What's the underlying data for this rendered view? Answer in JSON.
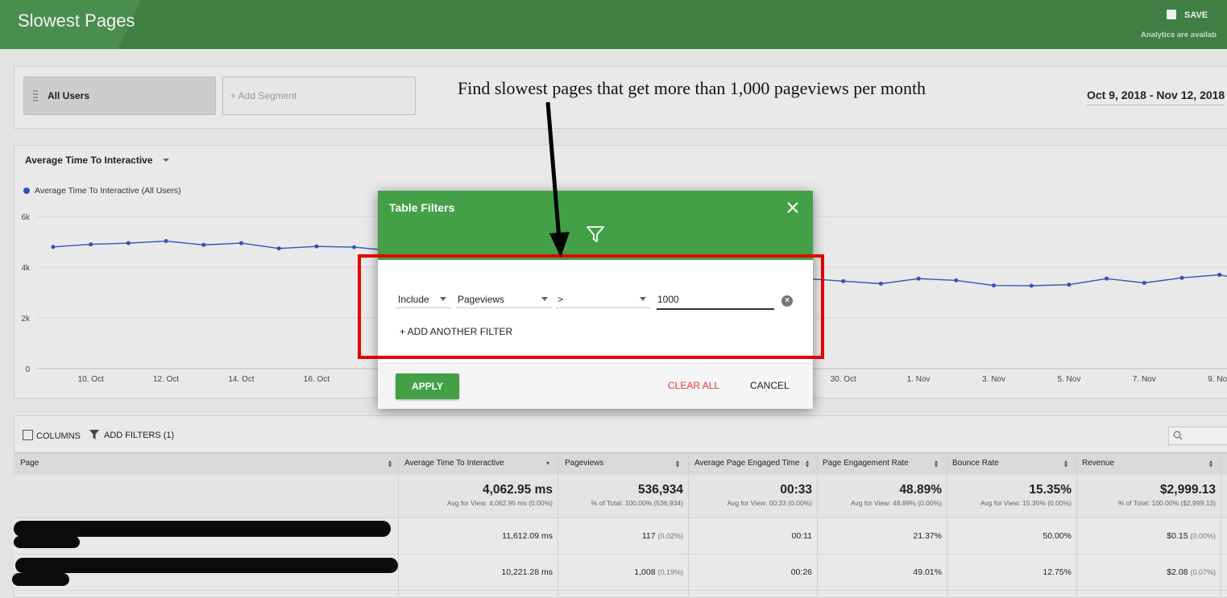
{
  "header": {
    "title": "Slowest Pages",
    "save_label": "SAVE",
    "availability_note": "Analytics are availab"
  },
  "segments": {
    "active": "All Users",
    "add": "+ Add Segment",
    "date_range": "Oct 9, 2018 - Nov 12, 2018"
  },
  "annotation": "Find slowest pages that get more than 1,000 pageviews per month",
  "chart": {
    "metric_selector": "Average Time To Interactive"
  },
  "chart_data": {
    "type": "line",
    "title": "",
    "legend": "Average Time To Interactive (All Users)",
    "ylabel": "",
    "xlabel": "",
    "ylim": [
      0,
      6000
    ],
    "y_ticks": [
      "0",
      "2k",
      "4k",
      "6k"
    ],
    "x_ticks": [
      "10. Oct",
      "12. Oct",
      "14. Oct",
      "16. Oct",
      "30. Oct",
      "1. Nov",
      "3. Nov",
      "5. Nov",
      "7. Nov",
      "9. Nov"
    ],
    "series": [
      {
        "name": "Average Time To Interactive (All Users)",
        "color": "#2c55b8",
        "x": [
          "2018-10-09",
          "2018-10-10",
          "2018-10-11",
          "2018-10-12",
          "2018-10-13",
          "2018-10-14",
          "2018-10-15",
          "2018-10-16",
          "2018-10-17",
          "2018-10-18",
          "2018-10-30",
          "2018-10-31",
          "2018-11-01",
          "2018-11-02",
          "2018-11-03",
          "2018-11-04",
          "2018-11-05",
          "2018-11-06",
          "2018-11-07",
          "2018-11-08",
          "2018-11-09",
          "2018-11-10"
        ],
        "values": [
          4800,
          4900,
          4950,
          5030,
          4880,
          4950,
          4740,
          4820,
          4790,
          4650,
          3450,
          3350,
          3550,
          3480,
          3280,
          3270,
          3310,
          3550,
          3380,
          3580,
          3700,
          3400
        ]
      }
    ]
  },
  "table": {
    "toolbar": {
      "columns": "COLUMNS",
      "add_filters": "ADD FILTERS (1)"
    },
    "headers": [
      "Page",
      "Average Time To Interactive",
      "Pageviews",
      "Average Page Engaged Time",
      "Page Engagement Rate",
      "Bounce Rate",
      "Revenue"
    ],
    "totals": [
      {
        "value": "4,062.95 ms",
        "sub": "Avg for View: 4,062.95 ms (0.00%)"
      },
      {
        "value": "536,934",
        "sub": "% of Total: 100.00% (536,934)"
      },
      {
        "value": "00:33",
        "sub": "Avg for View: 00:33 (0.00%)"
      },
      {
        "value": "48.89%",
        "sub": "Avg for View: 48.89% (0.00%)"
      },
      {
        "value": "15.35%",
        "sub": "Avg for View: 15.35% (0.00%)"
      },
      {
        "value": "$2,999.13",
        "sub": "% of Total: 100.00% ($2,999.13)"
      }
    ],
    "rows": [
      {
        "tti": "11,612.09 ms",
        "pv": "117",
        "pv_pct": "(0.02%)",
        "engaged": "00:11",
        "eng_rate": "21.37%",
        "bounce": "50.00%",
        "rev": "$0.15",
        "rev_pct": "(0.00%)"
      },
      {
        "tti": "10,221.28 ms",
        "pv": "1,008",
        "pv_pct": "(0.19%)",
        "engaged": "00:26",
        "eng_rate": "49.01%",
        "bounce": "12.75%",
        "rev": "$2.08",
        "rev_pct": "(0.07%)"
      }
    ]
  },
  "modal": {
    "title": "Table Filters",
    "include": "Include",
    "dimension": "Pageviews",
    "operator": ">",
    "value": "1000",
    "add_filter": "+ ADD ANOTHER FILTER",
    "apply": "APPLY",
    "clear_all": "CLEAR ALL",
    "cancel": "CANCEL"
  }
}
